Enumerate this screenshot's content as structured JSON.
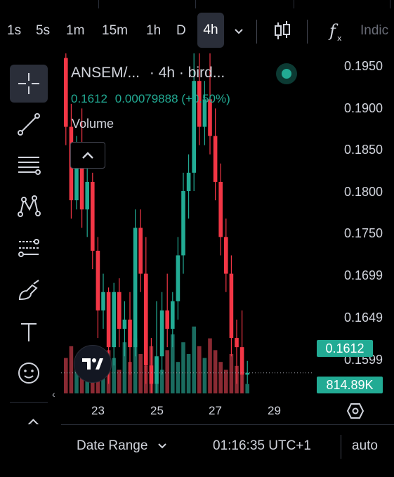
{
  "toolbar": {
    "intervals": [
      "1s",
      "5s",
      "1m",
      "15m",
      "1h",
      "D"
    ],
    "active_interval": "4h",
    "indicators_label": "Indic"
  },
  "legend": {
    "symbol": "ANSEM/...",
    "interval": "· 4h ·",
    "source": "bird...",
    "last_price": "0.1612",
    "change": "0.00079888",
    "change_pct": "(+0.50%)",
    "volume_label": "Volume"
  },
  "price_scale": {
    "labels": [
      "0.1950",
      "0.1900",
      "0.1850",
      "0.1800",
      "0.1750",
      "0.1699",
      "0.1649",
      "0.1599"
    ],
    "last_price_tag": "0.1612",
    "volume_tag": "814.89K"
  },
  "time_scale": {
    "labels": [
      "23",
      "25",
      "27",
      "29"
    ]
  },
  "bottom": {
    "date_range": "Date Range",
    "clock": "01:16:35 UTC+1",
    "scale_mode": "auto"
  },
  "colors": {
    "up": "#22ab94",
    "down": "#f23645",
    "background": "#000000"
  },
  "chart_data": {
    "type": "candlestick",
    "x_ticks": [
      "23",
      "25",
      "27",
      "29"
    ],
    "ylim": [
      0.1585,
      0.196
    ],
    "candles": [
      {
        "o": 0.1955,
        "h": 0.196,
        "c": 0.188,
        "l": 0.186
      },
      {
        "o": 0.188,
        "h": 0.1905,
        "c": 0.18,
        "l": 0.178
      },
      {
        "o": 0.18,
        "h": 0.187,
        "c": 0.185,
        "l": 0.179
      },
      {
        "o": 0.185,
        "h": 0.19,
        "c": 0.179,
        "l": 0.177
      },
      {
        "o": 0.179,
        "h": 0.184,
        "c": 0.182,
        "l": 0.176
      },
      {
        "o": 0.182,
        "h": 0.183,
        "c": 0.1745,
        "l": 0.1725
      },
      {
        "o": 0.1745,
        "h": 0.176,
        "c": 0.168,
        "l": 0.165
      },
      {
        "o": 0.168,
        "h": 0.172,
        "c": 0.17,
        "l": 0.166
      },
      {
        "o": 0.17,
        "h": 0.1705,
        "c": 0.164,
        "l": 0.16
      },
      {
        "o": 0.164,
        "h": 0.171,
        "c": 0.17,
        "l": 0.162
      },
      {
        "o": 0.17,
        "h": 0.1715,
        "c": 0.166,
        "l": 0.164
      },
      {
        "o": 0.166,
        "h": 0.169,
        "c": 0.167,
        "l": 0.163
      },
      {
        "o": 0.167,
        "h": 0.17,
        "c": 0.164,
        "l": 0.161
      },
      {
        "o": 0.164,
        "h": 0.179,
        "c": 0.177,
        "l": 0.163
      },
      {
        "o": 0.177,
        "h": 0.179,
        "c": 0.172,
        "l": 0.17
      },
      {
        "o": 0.172,
        "h": 0.176,
        "c": 0.162,
        "l": 0.16
      },
      {
        "o": 0.162,
        "h": 0.165,
        "c": 0.16,
        "l": 0.159
      },
      {
        "o": 0.16,
        "h": 0.169,
        "c": 0.163,
        "l": 0.159
      },
      {
        "o": 0.163,
        "h": 0.17,
        "c": 0.168,
        "l": 0.161
      },
      {
        "o": 0.168,
        "h": 0.172,
        "c": 0.166,
        "l": 0.164
      },
      {
        "o": 0.166,
        "h": 0.17,
        "c": 0.169,
        "l": 0.164
      },
      {
        "o": 0.169,
        "h": 0.176,
        "c": 0.174,
        "l": 0.167
      },
      {
        "o": 0.174,
        "h": 0.183,
        "c": 0.181,
        "l": 0.172
      },
      {
        "o": 0.181,
        "h": 0.185,
        "c": 0.183,
        "l": 0.178
      },
      {
        "o": 0.183,
        "h": 0.196,
        "c": 0.193,
        "l": 0.181
      },
      {
        "o": 0.193,
        "h": 0.196,
        "c": 0.188,
        "l": 0.186
      },
      {
        "o": 0.188,
        "h": 0.193,
        "c": 0.191,
        "l": 0.186
      },
      {
        "o": 0.191,
        "h": 0.196,
        "c": 0.187,
        "l": 0.185
      },
      {
        "o": 0.187,
        "h": 0.19,
        "c": 0.182,
        "l": 0.18
      },
      {
        "o": 0.182,
        "h": 0.184,
        "c": 0.176,
        "l": 0.174
      },
      {
        "o": 0.176,
        "h": 0.178,
        "c": 0.172,
        "l": 0.17
      },
      {
        "o": 0.172,
        "h": 0.174,
        "c": 0.165,
        "l": 0.163
      },
      {
        "o": 0.165,
        "h": 0.167,
        "c": 0.164,
        "l": 0.16
      },
      {
        "o": 0.164,
        "h": 0.168,
        "c": 0.161,
        "l": 0.159
      },
      {
        "o": 0.161,
        "h": 0.1625,
        "c": 0.1612,
        "l": 0.16
      }
    ],
    "volume_max": 1.0,
    "volume": [
      0.45,
      0.6,
      0.3,
      0.55,
      0.35,
      0.5,
      0.4,
      0.25,
      0.55,
      0.45,
      0.3,
      0.65,
      0.4,
      0.7,
      0.5,
      0.35,
      0.6,
      0.45,
      0.3,
      0.55,
      0.75,
      0.4,
      0.65,
      0.5,
      0.85,
      0.6,
      0.45,
      0.7,
      0.55,
      0.4,
      0.3,
      0.5,
      0.35,
      0.25,
      0.12
    ],
    "last_price": 0.1612,
    "last_volume": "814.89K"
  }
}
